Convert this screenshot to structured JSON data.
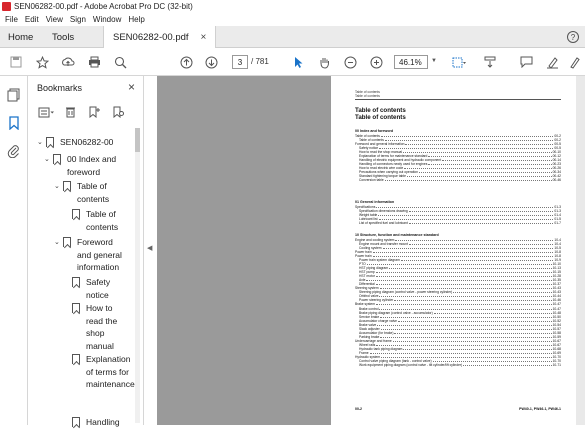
{
  "window": {
    "title": "SEN06282-00.pdf - Adobe Acrobat Pro DC (32-bit)"
  },
  "menu": [
    "File",
    "Edit",
    "View",
    "Sign",
    "Window",
    "Help"
  ],
  "tabs": {
    "home": "Home",
    "tools": "Tools",
    "document": "SEN06282-00.pdf",
    "close": "×",
    "help": "?"
  },
  "toolbar": {
    "page_current": "3",
    "page_total": "/ 781",
    "zoom": "46.1%"
  },
  "panel": {
    "title": "Bookmarks",
    "close": "×"
  },
  "bookmarks": [
    "SEN06282-00",
    "00 Index and foreword",
    "Table of contents",
    "Table of contents",
    "Foreword and general information",
    "Safety notice",
    "How to read the shop manual",
    "Explanation of terms for maintenance",
    "Handling"
  ],
  "page": {
    "header_line1": "Table of contents",
    "header_line2": "Table of contents",
    "title1": "Table of contents",
    "title2": "Table of contents",
    "sections": [
      {
        "heading": "00 Index and foreword",
        "rows": [
          [
            "Table of contents",
            "00-2"
          ],
          [
            "Table of contents",
            "00-2"
          ],
          [
            "Foreword and general information",
            "00-5"
          ],
          [
            "Safety notice",
            "00-5"
          ],
          [
            "How to read the shop manual",
            "00-10"
          ],
          [
            "Explanation of terms for maintenance standard",
            "00-12"
          ],
          [
            "Handling of electric equipment and hydraulic component",
            "00-14"
          ],
          [
            "Handling of connectors newly used for engines",
            "00-23"
          ],
          [
            "How to read electric wire code",
            "00-26"
          ],
          [
            "Precautions when carrying out operation",
            "00-34"
          ],
          [
            "Standard tightening torque table",
            "00-42"
          ],
          [
            "Conversion table",
            "00-46"
          ]
        ]
      },
      {
        "heading": "01 General information",
        "rows": [
          [
            "Specifications",
            "01-3"
          ],
          [
            "Specification dimensions drawing",
            "01-3"
          ],
          [
            "Weight table",
            "01-4"
          ],
          [
            "Lubricant list",
            "01-5"
          ],
          [
            "List of specified fuel and lubricant",
            "01-7"
          ]
        ]
      },
      {
        "heading": "10 Structure, function and maintenance standard",
        "rows": [
          [
            "Engine and cooling system",
            "10-4"
          ],
          [
            "Engine mount and transfer mount",
            "10-4"
          ],
          [
            "Cooling system",
            "10-5"
          ],
          [
            "Power train",
            "10-8"
          ],
          [
            "Power train",
            "10-8"
          ],
          [
            "Power train system diagram",
            "10-9"
          ],
          [
            "PTO",
            "10-10"
          ],
          [
            "HST piping diagram",
            "10-13"
          ],
          [
            "HST pump",
            "10-15"
          ],
          [
            "HST motor",
            "10-28"
          ],
          [
            "Axle",
            "10-35"
          ],
          [
            "Differential",
            "10-37"
          ],
          [
            "Steering system",
            "10-43"
          ],
          [
            "Steering piping diagram (control valve - power steering cylinder)",
            "10-43"
          ],
          [
            "Orbitrol valve",
            "10-44"
          ],
          [
            "Power steering cylinder",
            "10-46"
          ],
          [
            "Brake system",
            "10-47"
          ],
          [
            "Brake control",
            "10-47"
          ],
          [
            "Brake piping diagram (control valve - accumulator)",
            "10-48"
          ],
          [
            "Service brake",
            "10-50"
          ],
          [
            "Accumulator charge valve",
            "10-52"
          ],
          [
            "Brake valve",
            "10-54"
          ],
          [
            "Slack adjuster",
            "10-57"
          ],
          [
            "Accumulator (for brake)",
            "10-58"
          ],
          [
            "Parking brake",
            "10-59"
          ],
          [
            "Undercarriage and frame",
            "10-67"
          ],
          [
            "Wheel rails",
            "10-67"
          ],
          [
            "Hydraulic tank piping diagram",
            "10-68"
          ],
          [
            "Frame",
            "10-69"
          ],
          [
            "Hydraulic system",
            "10-70"
          ],
          [
            "Control valve piping diagram (tank - control valve)",
            "10-70"
          ],
          [
            "Work equipment piping diagram (control valve - tilt cylinder/lift cylinder)",
            "10-71"
          ]
        ]
      }
    ],
    "footer_left": "00-2",
    "footer_right": "PW40-1, PW46-1, PW46-1"
  }
}
